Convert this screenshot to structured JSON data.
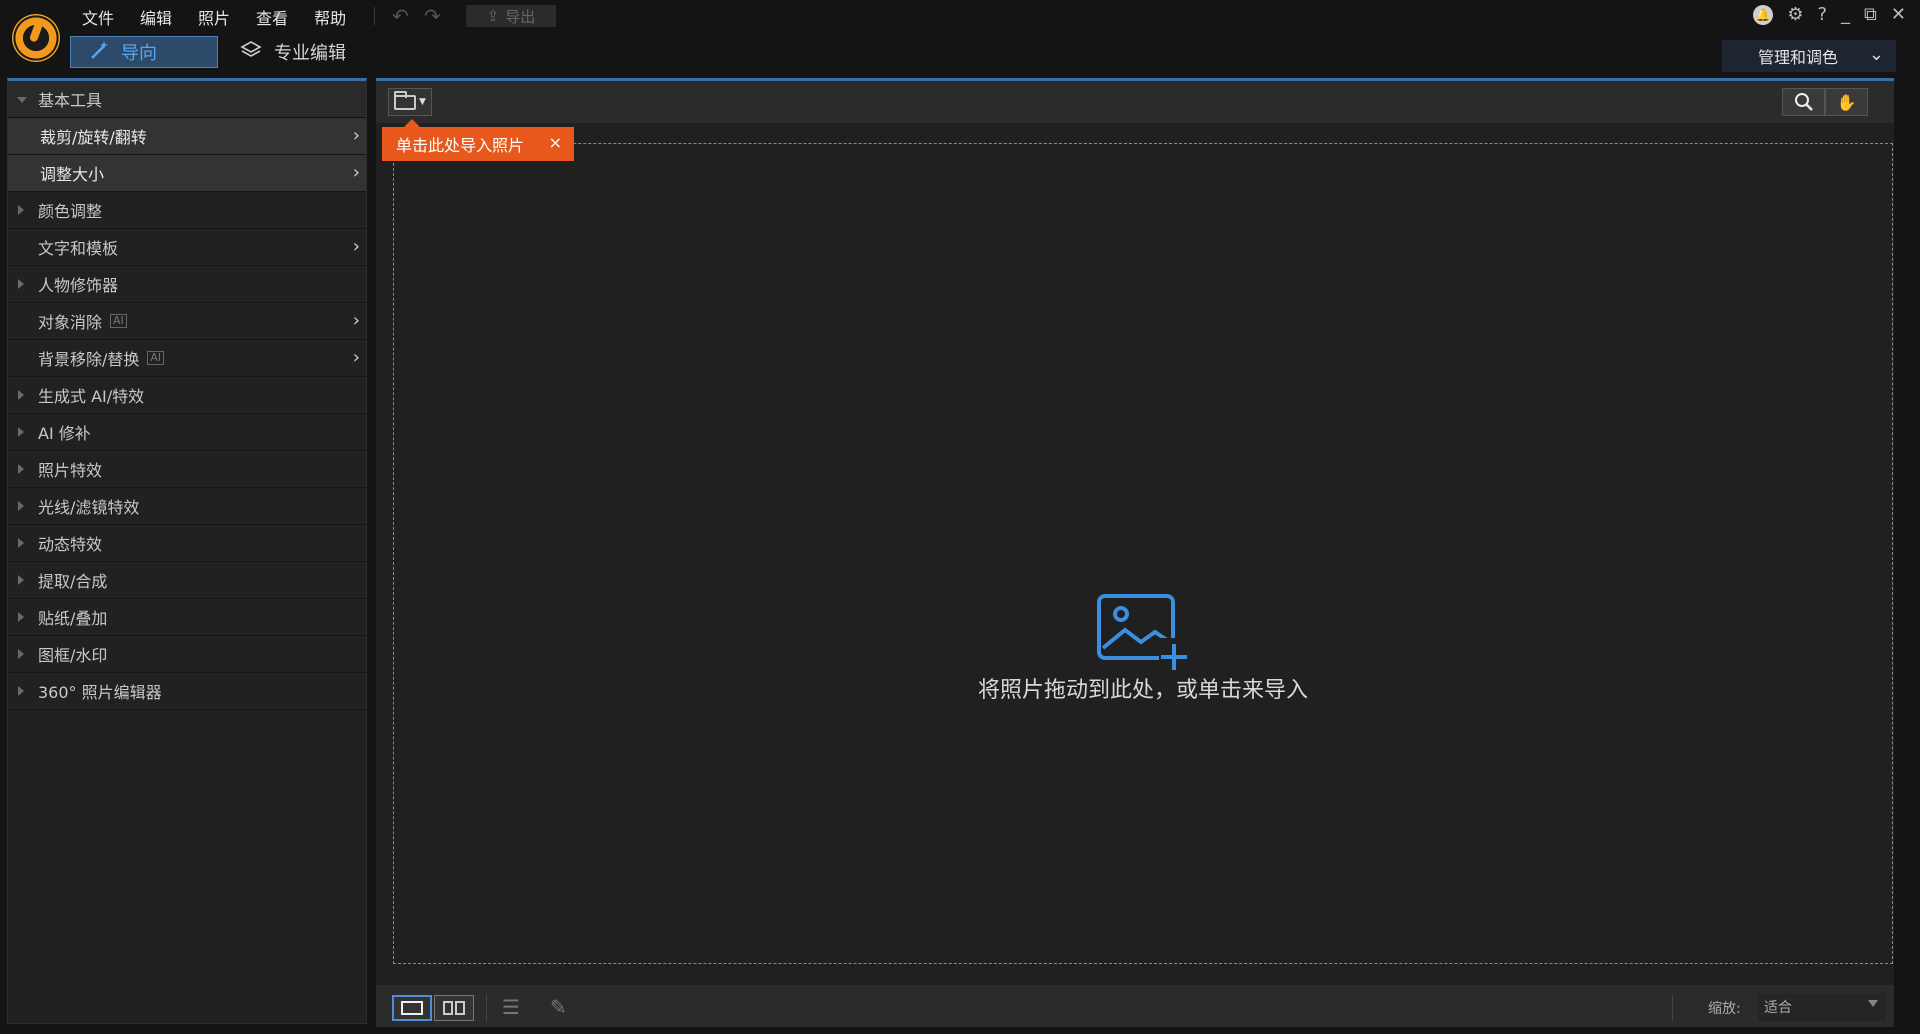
{
  "menu": [
    "文件",
    "编辑",
    "照片",
    "查看",
    "帮助"
  ],
  "toolbar": {
    "export_label": "导出"
  },
  "modes": {
    "guide_label": "导向",
    "pro_label": "专业编辑"
  },
  "right_controls": {
    "manage_label": "管理和调色",
    "help": "?",
    "minimize": "_",
    "restore": "⧉",
    "close": "✕"
  },
  "sidebar": {
    "items": [
      {
        "label": "基本工具",
        "kind": "header"
      },
      {
        "label": "裁剪/旋转/翻转",
        "kind": "sub"
      },
      {
        "label": "调整大小",
        "kind": "sub"
      },
      {
        "label": "颜色调整",
        "kind": "collapsed"
      },
      {
        "label": "文字和模板",
        "kind": "arrow"
      },
      {
        "label": "人物修饰器",
        "kind": "collapsed"
      },
      {
        "label": "对象消除",
        "kind": "arrow-ai"
      },
      {
        "label": "背景移除/替换",
        "kind": "arrow-ai"
      },
      {
        "label": "生成式 AI/特效",
        "kind": "collapsed"
      },
      {
        "label": "AI 修补",
        "kind": "collapsed"
      },
      {
        "label": "照片特效",
        "kind": "collapsed"
      },
      {
        "label": "光线/滤镜特效",
        "kind": "collapsed"
      },
      {
        "label": "动态特效",
        "kind": "collapsed"
      },
      {
        "label": "提取/合成",
        "kind": "collapsed"
      },
      {
        "label": "贴纸/叠加",
        "kind": "collapsed"
      },
      {
        "label": "图框/水印",
        "kind": "collapsed"
      },
      {
        "label": "360° 照片编辑器",
        "kind": "collapsed"
      }
    ]
  },
  "canvas": {
    "tooltip": "单击此处导入照片",
    "tooltip_close": "×",
    "drop_text": "将照片拖动到此处，或单击来导入"
  },
  "bottom": {
    "zoom_label": "缩放:",
    "zoom_value": "适合"
  },
  "colors": {
    "accent": "#3c6fa8",
    "tooltip": "#e8581c",
    "icon_blue": "#3b8ee0"
  }
}
